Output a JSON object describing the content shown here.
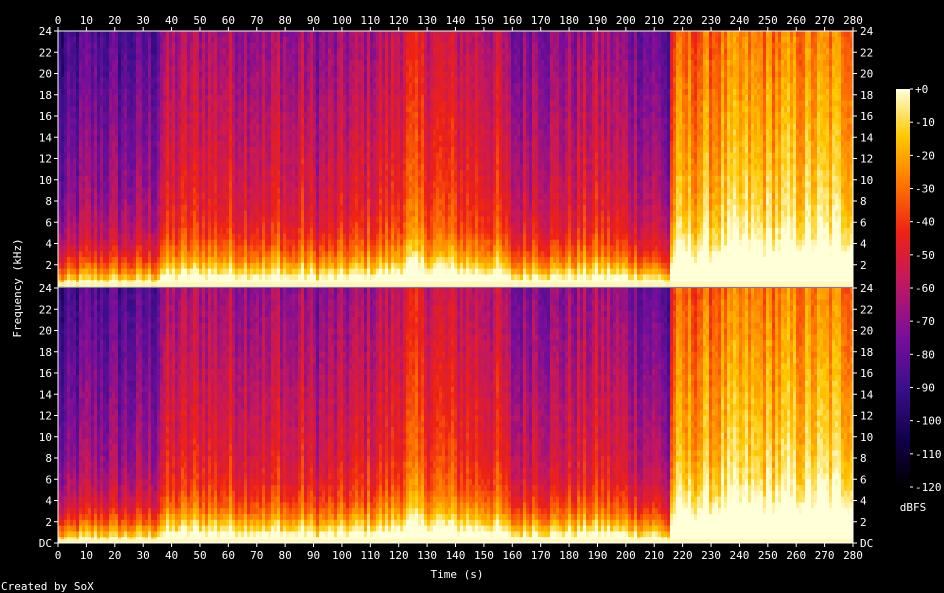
{
  "chart_data": {
    "type": "heatmap",
    "title": "",
    "xlabel": "Time (s)",
    "ylabel": "Frequency (kHz)",
    "x_ticks": [
      "0",
      "10",
      "20",
      "30",
      "40",
      "50",
      "60",
      "70",
      "80",
      "90",
      "100",
      "110",
      "120",
      "130",
      "140",
      "150",
      "160",
      "170",
      "180",
      "190",
      "200",
      "210",
      "220",
      "230",
      "240",
      "250",
      "260",
      "270",
      "280"
    ],
    "xlim": [
      0,
      280
    ],
    "channels": [
      {
        "ylim": [
          0,
          24
        ],
        "y_ticks": [
          "2",
          "4",
          "6",
          "8",
          "10",
          "12",
          "14",
          "16",
          "18",
          "20",
          "22",
          "24"
        ]
      },
      {
        "ylim": [
          0,
          24
        ],
        "y_ticks": [
          "DC",
          "2",
          "4",
          "6",
          "8",
          "10",
          "12",
          "14",
          "16",
          "18",
          "20",
          "22",
          "24"
        ]
      }
    ],
    "colorbar": {
      "label": "dBFS",
      "range": [
        -120,
        0
      ],
      "ticks": [
        "+0",
        "-10",
        "-20",
        "-30",
        "-40",
        "-50",
        "-60",
        "-70",
        "-80",
        "-90",
        "-100",
        "-110",
        "-120"
      ]
    },
    "palette": [
      "#000000",
      "#12004a",
      "#3a0f8c",
      "#7a0e9a",
      "#c4185c",
      "#ee2214",
      "#ff7400",
      "#ffc800",
      "#ffffd8"
    ],
    "level_profile": {
      "time_s": [
        0,
        3,
        10,
        25,
        34,
        36,
        50,
        70,
        74,
        77,
        82,
        85,
        90,
        100,
        118,
        122,
        140,
        155,
        159,
        161,
        168,
        172,
        190,
        205,
        213,
        214.5,
        216,
        240,
        280
      ],
      "energy": [
        0.34,
        0.36,
        0.44,
        0.42,
        0.44,
        0.56,
        0.6,
        0.58,
        0.52,
        0.62,
        0.5,
        0.6,
        0.52,
        0.55,
        0.62,
        0.7,
        0.64,
        0.62,
        0.5,
        0.48,
        0.58,
        0.52,
        0.58,
        0.5,
        0.46,
        0.38,
        0.82,
        0.88,
        0.9
      ]
    }
  },
  "footer": {
    "credit": "Created by SoX"
  }
}
